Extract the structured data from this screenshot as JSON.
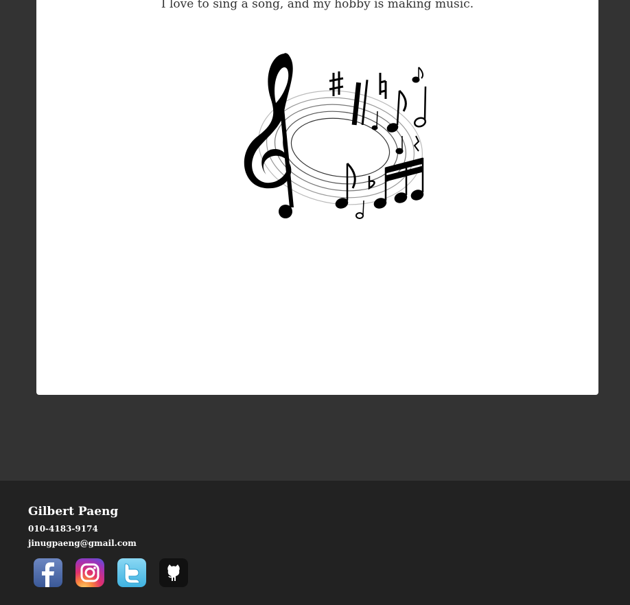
{
  "content": {
    "intro_text": "I love to sing a song, and my hobby is making music.",
    "image_icon": "music-notes-illustration"
  },
  "footer": {
    "name": "Gilbert Paeng",
    "phone": "010-4183-9174",
    "email": "jinugpaeng@gmail.com",
    "social_links": [
      {
        "icon": "facebook-icon"
      },
      {
        "icon": "instagram-icon"
      },
      {
        "icon": "twitter-icon"
      },
      {
        "icon": "github-icon"
      }
    ]
  },
  "colors": {
    "page_background": "#333333",
    "card_background": "#ffffff",
    "footer_background": "#222222",
    "footer_text": "#ffffff",
    "facebook": "#3b5998",
    "twitter": "#55c2ea",
    "github": "#111111"
  }
}
